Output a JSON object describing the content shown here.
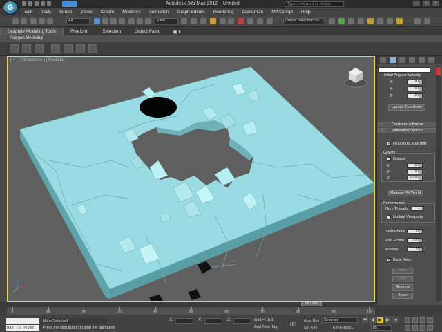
{
  "app": {
    "title": "Autodesk 3ds Max 2012",
    "document": "Untitled",
    "search_placeholder": "Type a keyword or phrase",
    "logo_letter": "G"
  },
  "menu": [
    "Edit",
    "Tools",
    "Group",
    "Views",
    "Create",
    "Modifiers",
    "Animation",
    "Graph Editors",
    "Rendering",
    "Customize",
    "MAXScript",
    "Help"
  ],
  "toolbar": {
    "selection_filter": "All",
    "ref_coord": "View",
    "named_selection": "Create Selection Se"
  },
  "ribbon": {
    "tabs": [
      "Graphite Modeling Tools",
      "Freeform",
      "Selection",
      "Object Paint"
    ],
    "active_tab": 0,
    "panel_label": "Polygon Modeling"
  },
  "viewport": {
    "label": "[ + ] [ Perspective ] [ Realistic ]"
  },
  "command_panel": {
    "transform_rollout_title": "Initial Angular Velocity",
    "velocity": {
      "x": "0.0",
      "y": "0.0",
      "z": "0.0"
    },
    "axis_labels": {
      "x": "X:",
      "y": "Y:",
      "z": "Z:"
    },
    "update_transform": "Update Transform",
    "fractures_advanced": "Fractures Advance",
    "simulation_options": "Simulation Options",
    "fit_units": "Fit units to Max grid",
    "gravity_label": "Gravity",
    "disable_label": "Disable",
    "gravity": {
      "x": "0.0",
      "y": "0.0",
      "z": "-100.0"
    },
    "manage_world": "Manage PX World",
    "performance_label": "Performance",
    "num_threads_label": "Num Threads",
    "num_threads": "1",
    "update_viewports": "Update Viewports",
    "start_frame_label": "Start Frame",
    "start_frame": "0",
    "end_frame_label": "End Frame",
    "end_frame": "100",
    "substep_label": "substep",
    "substep": "0",
    "bake_keys": "Bake Keys",
    "start_btn": "Start",
    "stop_btn": "Stop",
    "resume_btn": "Resume",
    "reset_btn": "Reset"
  },
  "timeline": {
    "slider_text": "85 / 100",
    "current_frame": 85,
    "total_frames": 100,
    "ticks": [
      "0",
      "10",
      "20",
      "30",
      "40",
      "50",
      "60",
      "70",
      "80",
      "90",
      "100"
    ]
  },
  "status": {
    "maxscript_top": "",
    "maxscript_bottom": "Max to Physc",
    "selection": "None Selected",
    "prompt": "Press the stop button to stop the animation",
    "x_label": "X:",
    "y_label": "Y:",
    "z_label": "Z:",
    "grid": "Grid = 10.0",
    "add_time_tag": "Add Time Tag",
    "auto_key": "Auto Key",
    "set_key": "Set Key",
    "key_filter_value": "Selected",
    "key_filters": "Key Filters...",
    "frame_field": "85"
  },
  "colors": {
    "mesh": "#98dbe2",
    "viewport_bg": "#5f5f5f",
    "active_border": "#e5d24a"
  }
}
